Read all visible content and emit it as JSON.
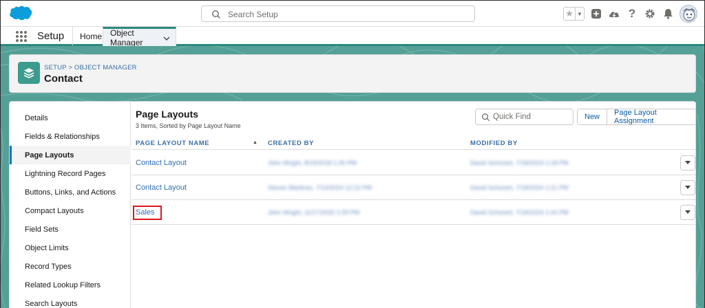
{
  "header": {
    "search_placeholder": "Search Setup",
    "icons": [
      "favorites-star-icon",
      "chevron-down-icon",
      "add-icon",
      "trailhead-icon",
      "help-icon",
      "gear-icon",
      "bell-icon",
      "avatar"
    ]
  },
  "context_bar": {
    "app_name": "Setup",
    "tabs": [
      {
        "label": "Home"
      },
      {
        "label": "Object Manager"
      }
    ]
  },
  "object_header": {
    "breadcrumb": "SETUP > OBJECT MANAGER",
    "title": "Contact"
  },
  "sidebar": {
    "items": [
      {
        "label": "Details"
      },
      {
        "label": "Fields & Relationships"
      },
      {
        "label": "Page Layouts",
        "active": true
      },
      {
        "label": "Lightning Record Pages"
      },
      {
        "label": "Buttons, Links, and Actions"
      },
      {
        "label": "Compact Layouts"
      },
      {
        "label": "Field Sets"
      },
      {
        "label": "Object Limits"
      },
      {
        "label": "Record Types"
      },
      {
        "label": "Related Lookup Filters"
      },
      {
        "label": "Search Layouts"
      }
    ]
  },
  "page_layouts": {
    "title": "Page Layouts",
    "subtitle": "3 Items, Sorted by Page Layout Name",
    "quick_find_placeholder": "Quick Find",
    "new_button": "New",
    "assignment_button": "Page Layout Assignment",
    "columns": [
      "PAGE LAYOUT NAME",
      "CREATED BY",
      "MODIFIED BY"
    ],
    "rows": [
      {
        "name": "Contact Layout",
        "created_by": "John Wright, 8/19/2018 1:30 PM",
        "modified_by": "David Schonert, 7/18/2024 1:18 PM"
      },
      {
        "name": "Contact Layout",
        "created_by": "Steven Martinez, 7/13/2024 12:22 PM",
        "modified_by": "David Schonert, 7/18/2024 1:21 PM"
      },
      {
        "name": "Sales",
        "created_by": "John Wright, 11/17/2020 1:59 PM",
        "modified_by": "David Schonert, 7/18/2024 1:44 PM",
        "highlighted": true
      }
    ]
  },
  "colors": {
    "brand_blue": "#0176d3",
    "teal": "#54a097",
    "link": "#2e6fb3",
    "highlight_red": "#e0151b"
  }
}
